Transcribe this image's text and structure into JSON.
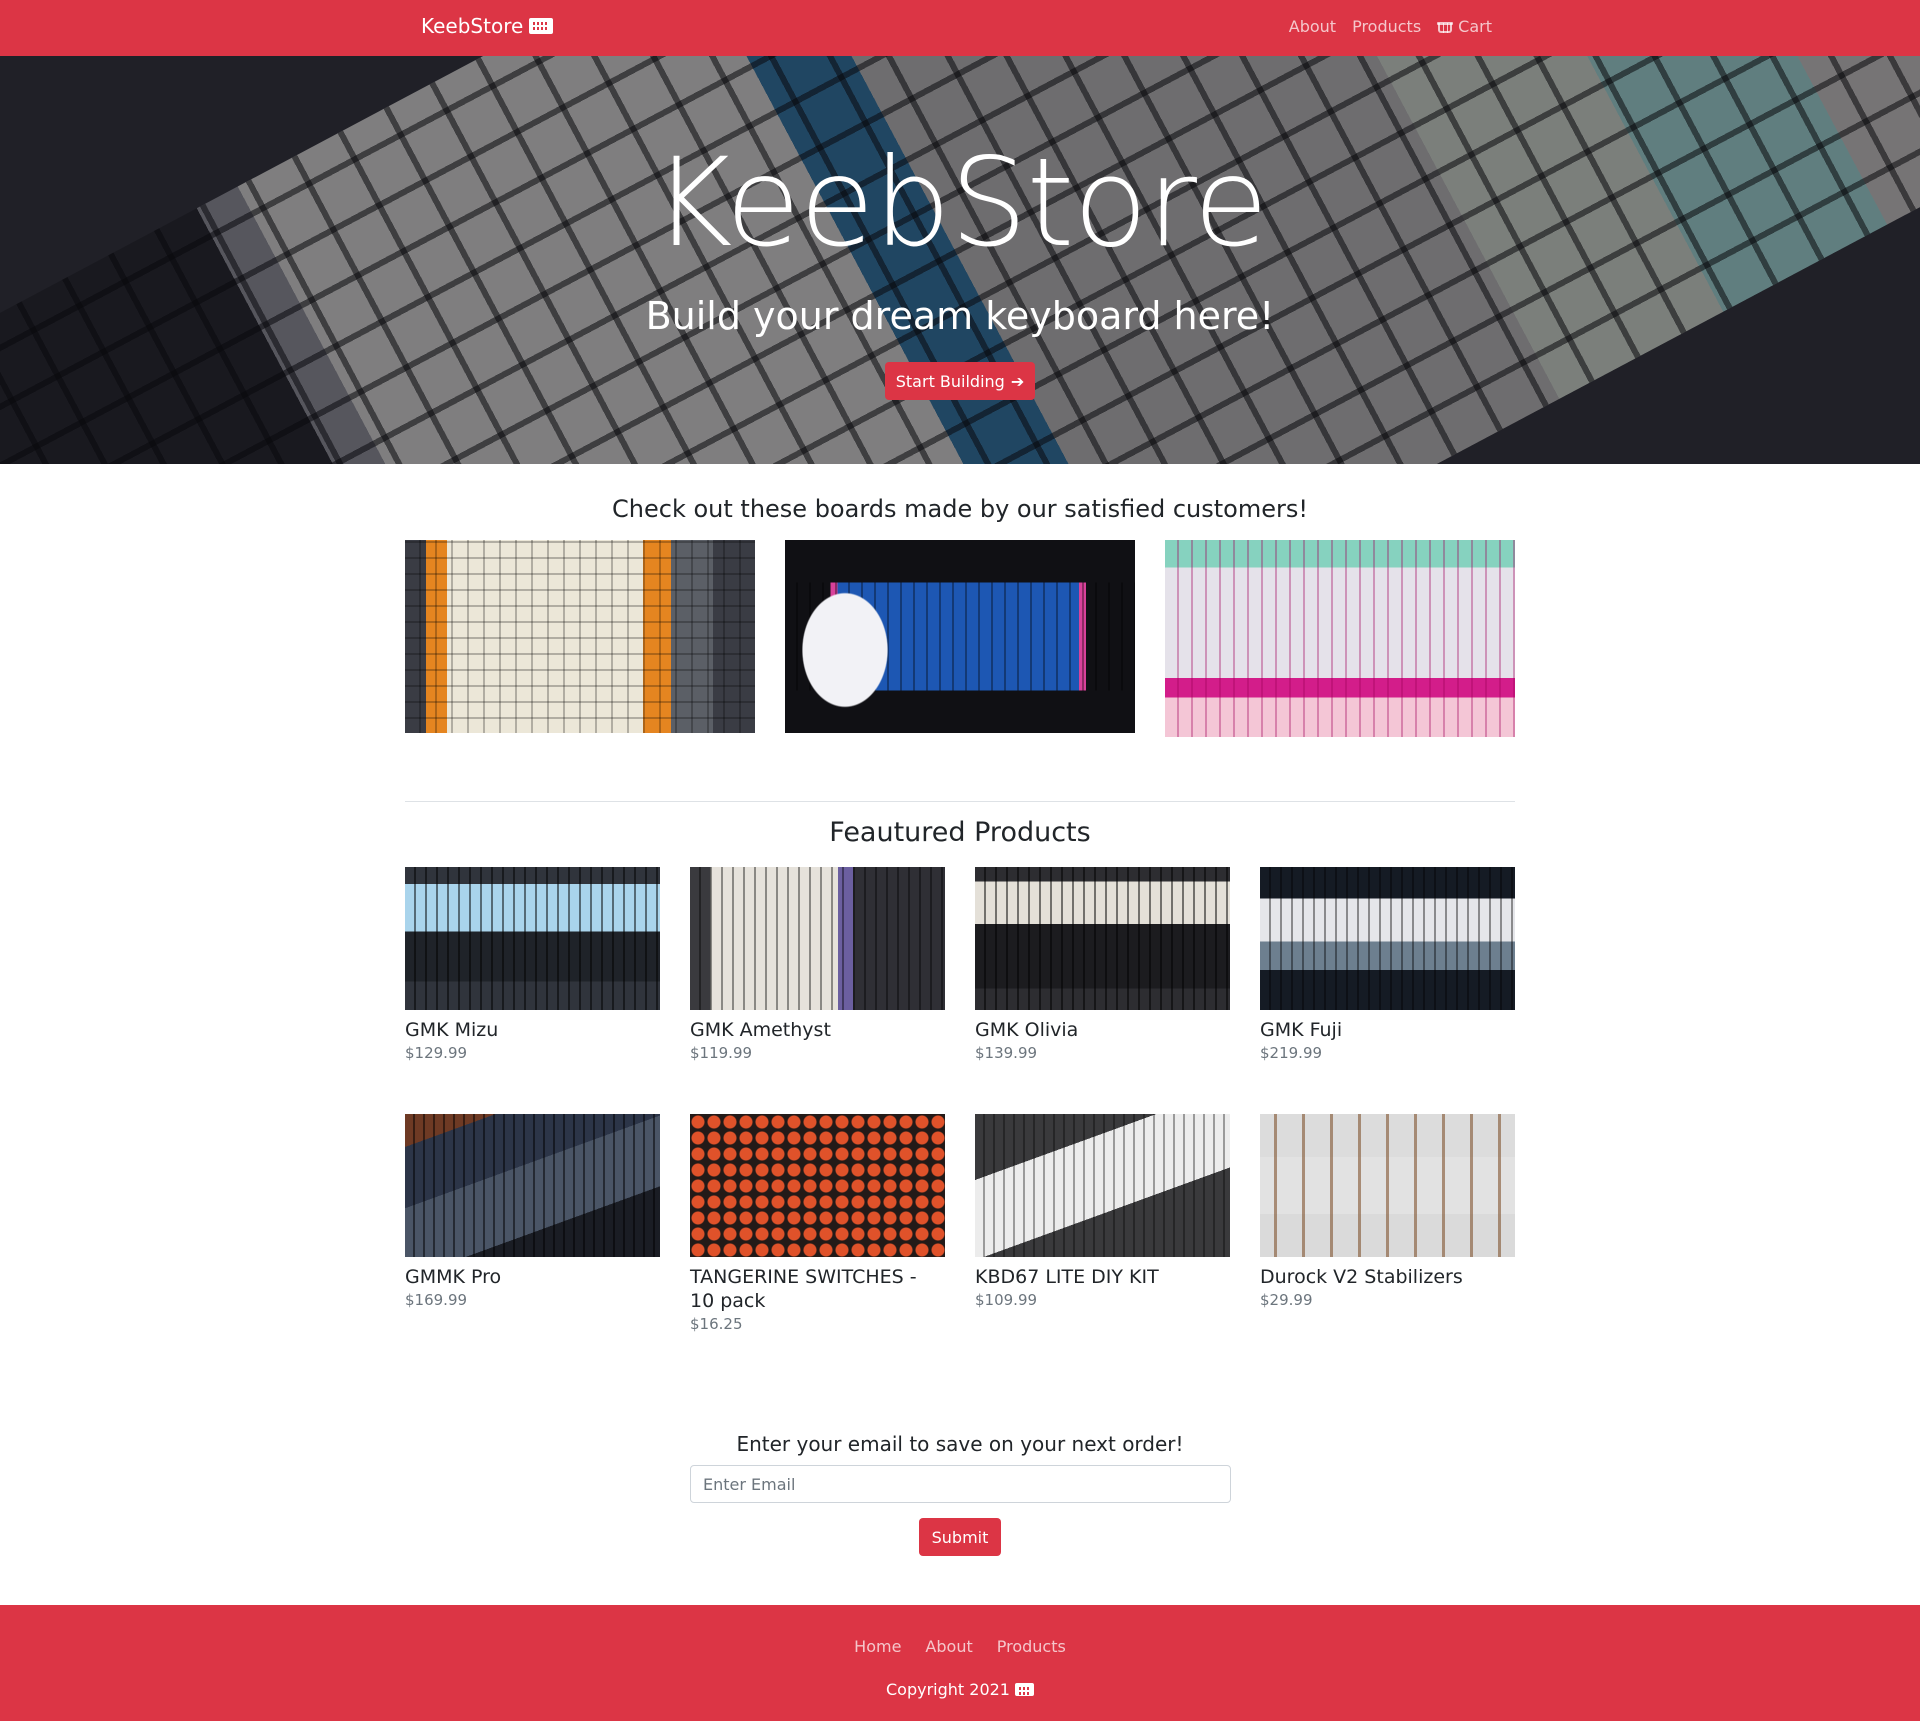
{
  "navbar": {
    "brand": "KeebStore",
    "brand_icon": "keyboard-icon",
    "links": [
      "About",
      "Products",
      "Cart"
    ],
    "cart_icon": "basket-icon",
    "bg_color": "#dc3545"
  },
  "hero": {
    "title": "KeebStore",
    "subtitle": "Build your dream keyboard here!",
    "button_label": "Start Building",
    "button_icon": "arrow-right-icon",
    "arrow": "➔"
  },
  "customers": {
    "heading": "Check out these boards made by our satisfied customers!"
  },
  "products": {
    "heading": "Feautured Products",
    "items": [
      {
        "name": "GMK Mizu",
        "price": "$129.99"
      },
      {
        "name": "GMK Amethyst",
        "price": "$119.99"
      },
      {
        "name": "GMK Olivia",
        "price": "$139.99"
      },
      {
        "name": "GMK Fuji",
        "price": "$219.99"
      },
      {
        "name": "GMMK Pro",
        "price": "$169.99"
      },
      {
        "name": "TANGERINE SWITCHES - 10 pack",
        "price": "$16.25"
      },
      {
        "name": "KBD67 LITE DIY KIT",
        "price": "$109.99"
      },
      {
        "name": "Durock V2 Stabilizers",
        "price": "$29.99"
      }
    ]
  },
  "newsletter": {
    "heading": "Enter your email to save on your next order!",
    "placeholder": "Enter Email",
    "submit_label": "Submit"
  },
  "footer": {
    "links": [
      "Home",
      "About",
      "Products"
    ],
    "copyright": "Copyright 2021"
  }
}
